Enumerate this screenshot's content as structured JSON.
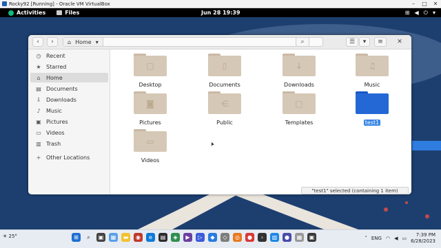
{
  "vbox": {
    "title": "Rocky92 [Running] - Oracle VM VirtualBox",
    "min": "–",
    "max": "□",
    "close": "✕"
  },
  "gnome": {
    "activities": "Activities",
    "app_menu": "Files",
    "clock": "Jun 28  19:39"
  },
  "files_window": {
    "location": "Home",
    "sidebar": [
      {
        "label": "Recent",
        "icon": "clock-icon",
        "glyph": "◷"
      },
      {
        "label": "Starred",
        "icon": "star-icon",
        "glyph": "★"
      },
      {
        "label": "Home",
        "icon": "home-icon",
        "glyph": "⌂"
      },
      {
        "label": "Documents",
        "icon": "document-icon",
        "glyph": "▤"
      },
      {
        "label": "Downloads",
        "icon": "download-icon",
        "glyph": "⇩"
      },
      {
        "label": "Music",
        "icon": "music-icon",
        "glyph": "♪"
      },
      {
        "label": "Pictures",
        "icon": "camera-icon",
        "glyph": "▣"
      },
      {
        "label": "Videos",
        "icon": "video-icon",
        "glyph": "▭"
      },
      {
        "label": "Trash",
        "icon": "trash-icon",
        "glyph": "▥"
      },
      {
        "label": "Other Locations",
        "icon": "plus-icon",
        "glyph": "+"
      }
    ],
    "active_sidebar": "Home",
    "items": [
      {
        "label": "Desktop",
        "glyph": "▢"
      },
      {
        "label": "Documents",
        "glyph": "▯"
      },
      {
        "label": "Downloads",
        "glyph": "↓"
      },
      {
        "label": "Music",
        "glyph": "♫"
      },
      {
        "label": "Pictures",
        "glyph": "◙"
      },
      {
        "label": "Public",
        "glyph": "⋲"
      },
      {
        "label": "Templates",
        "glyph": "▢"
      },
      {
        "label": "test1",
        "glyph": ""
      },
      {
        "label": "Videos",
        "glyph": "▭"
      }
    ],
    "selected_item": "test1",
    "status": "\"test1\" selected  (containing 1 item)"
  },
  "taskbar": {
    "temperature": "25°",
    "language": "ENG",
    "time": "7:39 PM",
    "date": "6/28/2023"
  },
  "colors": {
    "accent": "#3584e4",
    "desktop": "#1d3f70",
    "folder": "#d6c8b6",
    "folder_selected": "#2468d6"
  }
}
